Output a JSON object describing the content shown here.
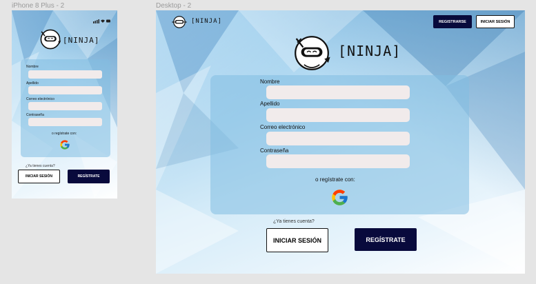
{
  "mobile": {
    "frame_label": "iPhone 8 Plus - 2",
    "brand": "[NINJA]",
    "fields": [
      {
        "label": "Nombre"
      },
      {
        "label": "Apellido"
      },
      {
        "label": "Correo electrónico"
      },
      {
        "label": "Contraseña"
      }
    ],
    "register_with": "o regístrate con:",
    "have_account": "¿Ya tienes cuenta?",
    "login_button": "INICIAR SESIÓN",
    "register_button": "REGÍSTRATE"
  },
  "desktop": {
    "frame_label": "Desktop - 2",
    "header_brand": "[NINJA]",
    "header_register_button": "REGISTRARSE",
    "header_login_button": "INICIAR SESIÓN",
    "brand": "[NINJA]",
    "fields": [
      {
        "label": "Nombre"
      },
      {
        "label": "Apellido"
      },
      {
        "label": "Correo electrónico"
      },
      {
        "label": "Contraseña"
      }
    ],
    "register_with": "o regístrate con:",
    "have_account": "¿Ya tienes cuenta?",
    "login_button": "INICIAR SESIÓN",
    "register_button": "REGÍSTRATE"
  },
  "colors": {
    "dark_button": "#080a3c",
    "field_bg": "#f1ebeb",
    "google_blue": "#4285F4",
    "google_red": "#EA4335",
    "google_yellow": "#FBBC05",
    "google_green": "#34A853"
  },
  "icons": {
    "logo": "ninja-mascot-icon",
    "social": "google-icon"
  }
}
